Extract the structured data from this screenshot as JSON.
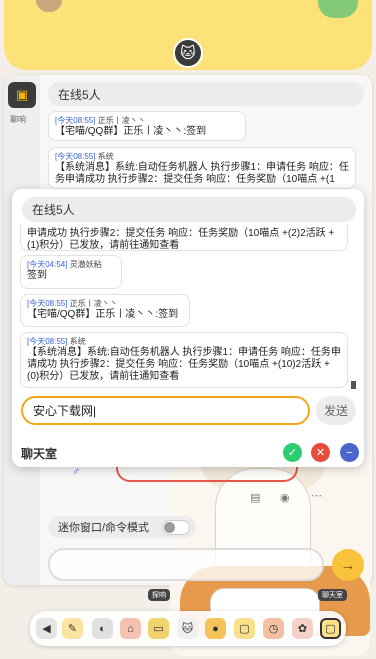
{
  "online_count": "在线5人",
  "sidebar_label": "聊响",
  "messages_bg": [
    {
      "time": "[今天08:55]",
      "name": "正乐丨凌丶丶",
      "text": "【宅喵/QQ群】正乐丨凌丶丶:签到"
    },
    {
      "time": "[今天08:55]",
      "name": "系统",
      "text": "【系统消息】系统:自动任务机器人 执行步骤1：申请任务 响应：任务申请成功 执行步骤2：提交任务 响应：任务奖励（10喵点 +(1"
    }
  ],
  "dialog": {
    "online_count": "在线5人",
    "messages": [
      {
        "time": "",
        "name": "",
        "text": "申请成功 执行步骤2：提交任务 响应：任务奖励（10喵点 +(2)2活跃 +(1)积分）已发放，请前往通知查看"
      },
      {
        "time": "[今天04:54]",
        "name": "灵澈妖粘",
        "text": "签到"
      },
      {
        "time": "[今天08:55]",
        "name": "正乐丨凌丶丶",
        "text": "【宅喵/QQ群】正乐丨凌丶丶:签到"
      },
      {
        "time": "[今天08:55]",
        "name": "系统",
        "text": "【系统消息】系统:自动任务机器人 执行步骤1：申请任务 响应：任务申请成功 执行步骤2：提交任务 响应：任务奖励（10喵点 +(10)2活跃 +(0)积分）已发放，请前往通知查看"
      }
    ],
    "input_value": "安心下载网",
    "send_label": "发送",
    "title": "聊天室",
    "controls": {
      "confirm_color": "#2ecc71",
      "close_color": "#e74c3c",
      "minimize_color": "#4a66cc"
    }
  },
  "mini_mode_label": "迷你窗口/命令模式",
  "tag_left": "探响",
  "tag_right": "聊天室",
  "dock_icons": [
    "back-icon",
    "pencil-icon",
    "compass-icon",
    "home-icon",
    "note-icon",
    "cat-icon",
    "pin-icon",
    "chat-icon",
    "clock-icon",
    "flower-icon",
    "window-icon"
  ],
  "accent": "#f2a71b"
}
